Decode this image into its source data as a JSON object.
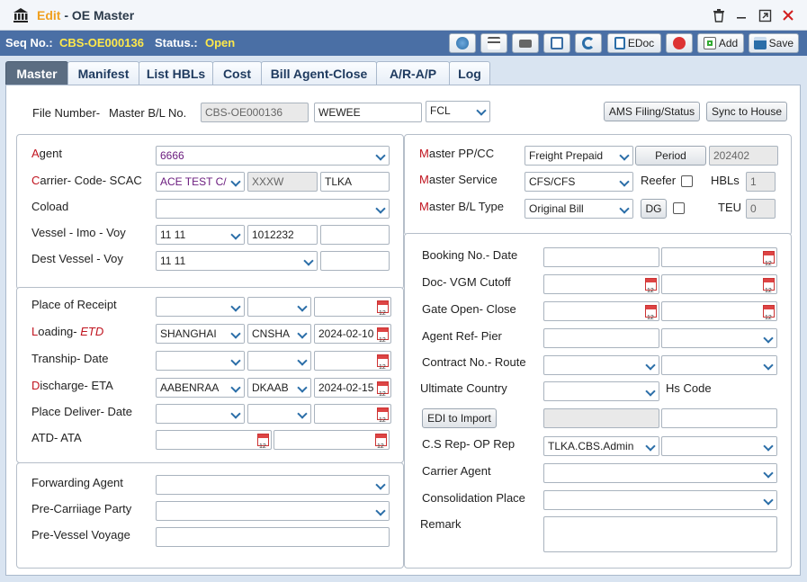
{
  "window": {
    "title_mode": "Edit",
    "title_sep": " - ",
    "title": "OE Master"
  },
  "toolbar": {
    "seq_label": "Seq No.:",
    "seq_value": "CBS-OE000136",
    "status_label": "Status.:",
    "status_value": "Open",
    "edoc_label": "EDoc",
    "add_label": "Add",
    "save_label": "Save"
  },
  "tabs": [
    {
      "label": "Master"
    },
    {
      "label": "Manifest"
    },
    {
      "label": "List HBLs"
    },
    {
      "label": "Cost"
    },
    {
      "label": "Bill Agent-Close"
    },
    {
      "label": "A/R-A/P"
    },
    {
      "label": "Log"
    }
  ],
  "header": {
    "file_number_label": "File Number-",
    "mbl_label": "Master B/L No.",
    "file_number": "CBS-OE000136",
    "mbl_no": "WEWEE",
    "load_type": "FCL",
    "ams_button": "AMS Filing/Status",
    "sync_button": "Sync to House"
  },
  "agent_box": {
    "agent_label_first": "A",
    "agent_label_rest": "gent",
    "agent_value": "6666",
    "carrier_label_first": "C",
    "carrier_label_rest": "arrier- Code- SCAC",
    "carrier_value": "ACE TEST C/",
    "carrier_code": "XXXW",
    "scac": "TLKA",
    "coload_label": "Coload",
    "vessel_label": "Vessel - Imo - Voy",
    "vessel_value": "11 11",
    "imo": "1012232",
    "voy": "",
    "dest_vessel_label": "Dest Vessel - Voy",
    "dest_vessel_value": "11 11",
    "dest_voy": ""
  },
  "routing_box": {
    "receipt_label": "Place of Receipt",
    "loading_label_first": "L",
    "loading_label_rest": "oading- ",
    "loading_label_etd": "ETD",
    "loading_port": "SHANGHAI",
    "loading_code": "CNSHA",
    "loading_etd": "2024-02-10",
    "transhipment_label": "Tranship- Date",
    "discharge_label_first": "D",
    "discharge_label_rest": "ischarge- ETA",
    "discharge_port": "AABENRAA",
    "discharge_code": "DKAAB",
    "discharge_eta": "2024-02-15 0(",
    "deliver_label": "Place Deliver- Date",
    "atd_label": "ATD- ATA"
  },
  "parties_box": {
    "forwarding_label": "Forwarding Agent",
    "precarriage_label": "Pre-Carriiage Party",
    "prevessel_label": "Pre-Vessel Voyage"
  },
  "master_box": {
    "ppcc_label_first": "M",
    "ppcc_label_rest": "aster PP/CC",
    "ppcc_value": "Freight Prepaid",
    "period_button": "Period",
    "period_value": "202402",
    "service_label_first": "M",
    "service_label_rest": "aster Service",
    "service_value": "CFS/CFS",
    "reefer_label": "Reefer",
    "hbls_label": "HBLs",
    "hbls_value": "1",
    "bl_type_label_first": "M",
    "bl_type_label_rest": "aster B/L Type",
    "bl_type_value": "Original Bill",
    "dg_button": "DG",
    "teu_label": "TEU",
    "teu_value": "0"
  },
  "booking_box": {
    "booking_label": "Booking No.- Date",
    "doc_vgm_label": "Doc- VGM Cutoff",
    "gate_label": "Gate Open- Close",
    "agent_ref_label": "Agent Ref- Pier",
    "contract_label": "Contract No.- Route",
    "ultimate_label": "Ultimate Country",
    "hs_code_label": "Hs Code",
    "edi_button": "EDI to Import",
    "cs_rep_label": "C.S Rep- OP Rep",
    "cs_rep_value": "TLKA.CBS.Admin",
    "carrier_agent_label": "Carrier Agent",
    "consolidation_label": "Consolidation Place",
    "remark_label": "Remark"
  },
  "colors": {
    "toolbar": "#4a6fa5",
    "required": "#c0141f",
    "status": "#ffe94a",
    "title_mode": "#f0a020"
  },
  "icons": [
    "bank-icon",
    "trash-icon",
    "minimize-icon",
    "maximize-icon",
    "close-icon",
    "calendar-icon",
    "chevron-down-icon"
  ]
}
